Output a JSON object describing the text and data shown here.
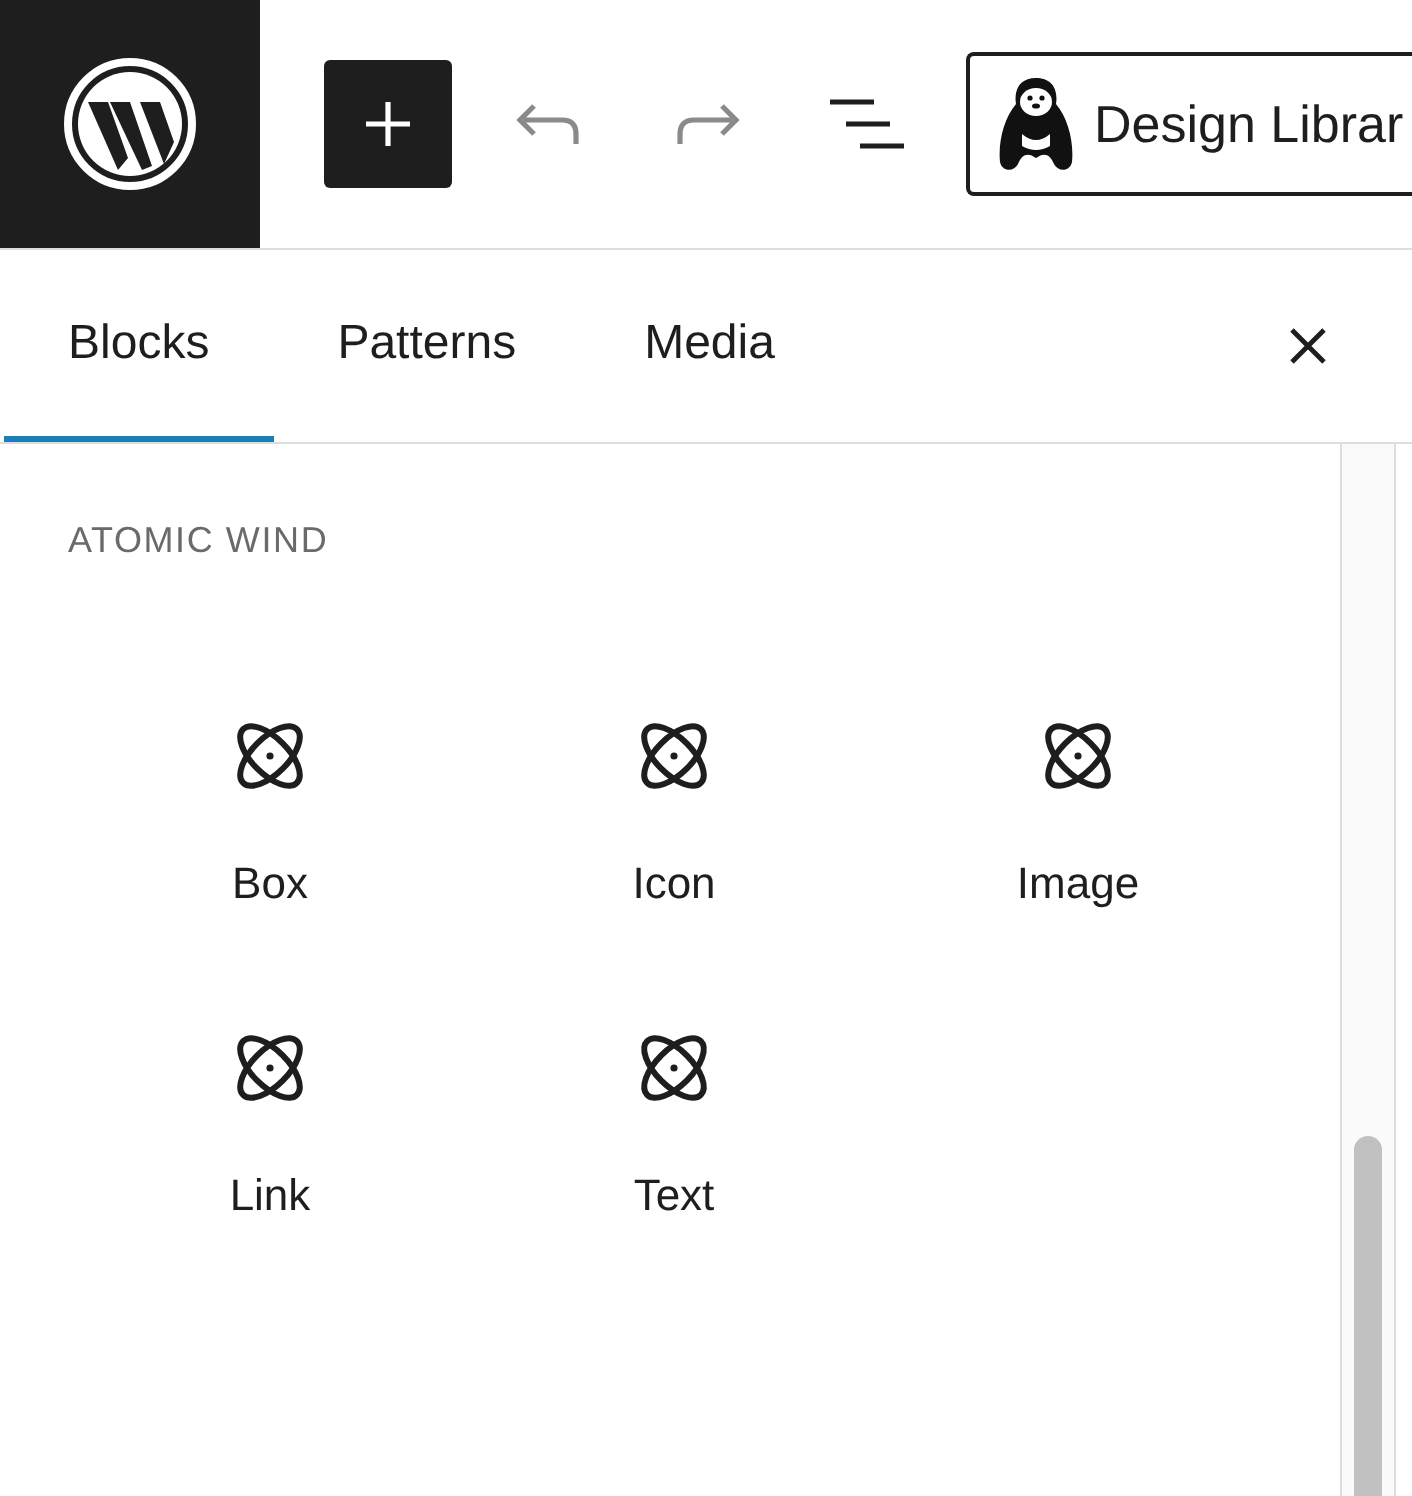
{
  "toolbar": {
    "library_button": {
      "label": "Design Librar"
    }
  },
  "tabs": [
    {
      "label": "Blocks",
      "selected": true
    },
    {
      "label": "Patterns",
      "selected": false
    },
    {
      "label": "Media",
      "selected": false
    }
  ],
  "section": {
    "heading": "ATOMIC WIND",
    "blocks": [
      {
        "label": "Box"
      },
      {
        "label": "Icon"
      },
      {
        "label": "Image"
      },
      {
        "label": "Link"
      },
      {
        "label": "Text"
      }
    ]
  }
}
